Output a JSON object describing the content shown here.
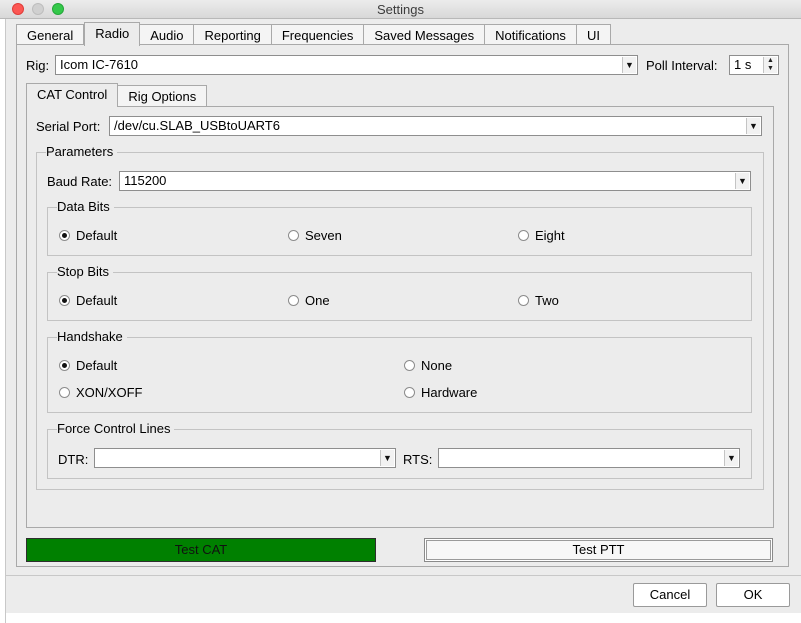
{
  "window": {
    "title": "Settings"
  },
  "tabs": [
    "General",
    "Radio",
    "Audio",
    "Reporting",
    "Frequencies",
    "Saved Messages",
    "Notifications",
    "UI"
  ],
  "rig": {
    "label": "Rig:",
    "value": "Icom IC-7610",
    "poll_label": "Poll Interval:",
    "poll_value": "1 s"
  },
  "subtabs": [
    "CAT Control",
    "Rig Options"
  ],
  "serial": {
    "label": "Serial Port:",
    "value": "/dev/cu.SLAB_USBtoUART6"
  },
  "parameters": {
    "title": "Parameters",
    "baud_label": "Baud Rate:",
    "baud_value": "115200",
    "data_bits": {
      "title": "Data Bits",
      "options": [
        "Default",
        "Seven",
        "Eight"
      ],
      "selected": "Default"
    },
    "stop_bits": {
      "title": "Stop Bits",
      "options": [
        "Default",
        "One",
        "Two"
      ],
      "selected": "Default"
    },
    "handshake": {
      "title": "Handshake",
      "options": [
        "Default",
        "None",
        "XON/XOFF",
        "Hardware"
      ],
      "selected": "Default"
    },
    "force_lines": {
      "title": "Force Control Lines",
      "dtr_label": "DTR:",
      "dtr_value": "",
      "rts_label": "RTS:",
      "rts_value": ""
    }
  },
  "buttons": {
    "test_cat": "Test CAT",
    "test_ptt": "Test PTT",
    "cancel": "Cancel",
    "ok": "OK"
  },
  "colors": {
    "test_cat_bg": "#008000"
  }
}
